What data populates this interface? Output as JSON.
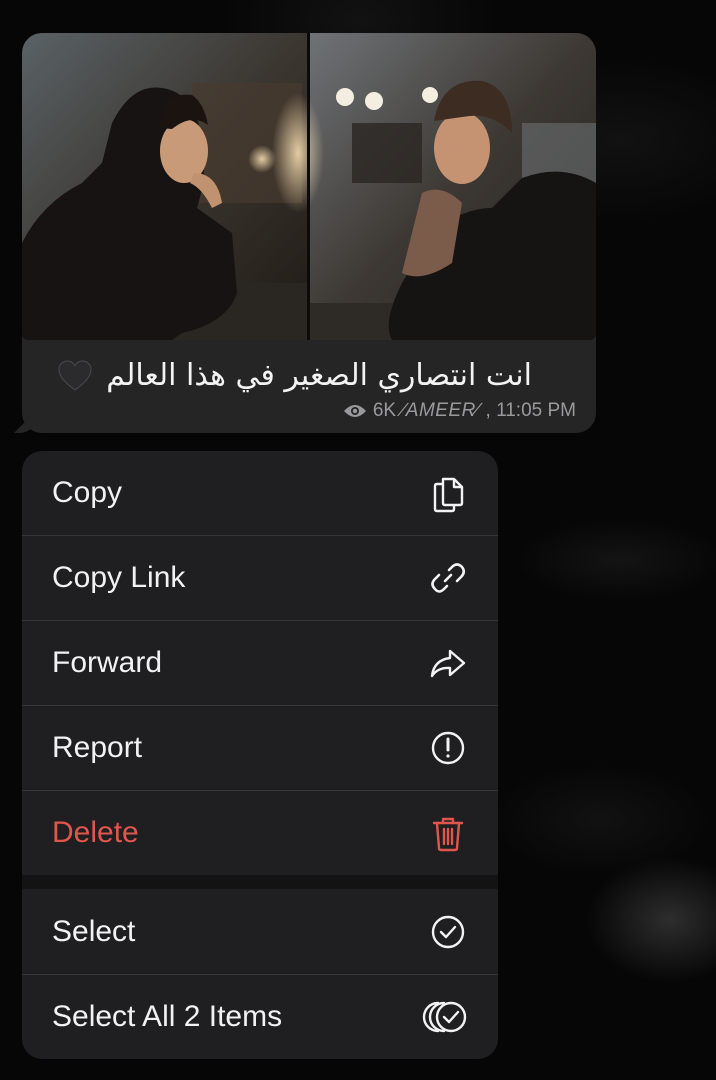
{
  "message": {
    "caption": "انت انتصاري الصغير في هذا العالم",
    "emoji": "black-heart",
    "views": "6K",
    "signature": "∕AMEER∕",
    "time": ", 11:05 PM",
    "photo_description_icon": "photo-thumbnail"
  },
  "menu": {
    "items": [
      {
        "label": "Copy",
        "icon": "copy-icon"
      },
      {
        "label": "Copy Link",
        "icon": "link-icon"
      },
      {
        "label": "Forward",
        "icon": "forward-icon"
      },
      {
        "label": "Report",
        "icon": "report-icon"
      },
      {
        "label": "Delete",
        "icon": "trash-icon",
        "color": "#e0564c"
      },
      {
        "label": "Select",
        "icon": "check-circle-icon"
      },
      {
        "label": "Select All 2 Items",
        "icon": "multi-select-icon"
      }
    ]
  },
  "colors": {
    "background": "#050505",
    "bubble": "#252526",
    "menu": "#1f1f21",
    "destructive": "#e0564c",
    "meta_text": "#9a9a9c"
  }
}
